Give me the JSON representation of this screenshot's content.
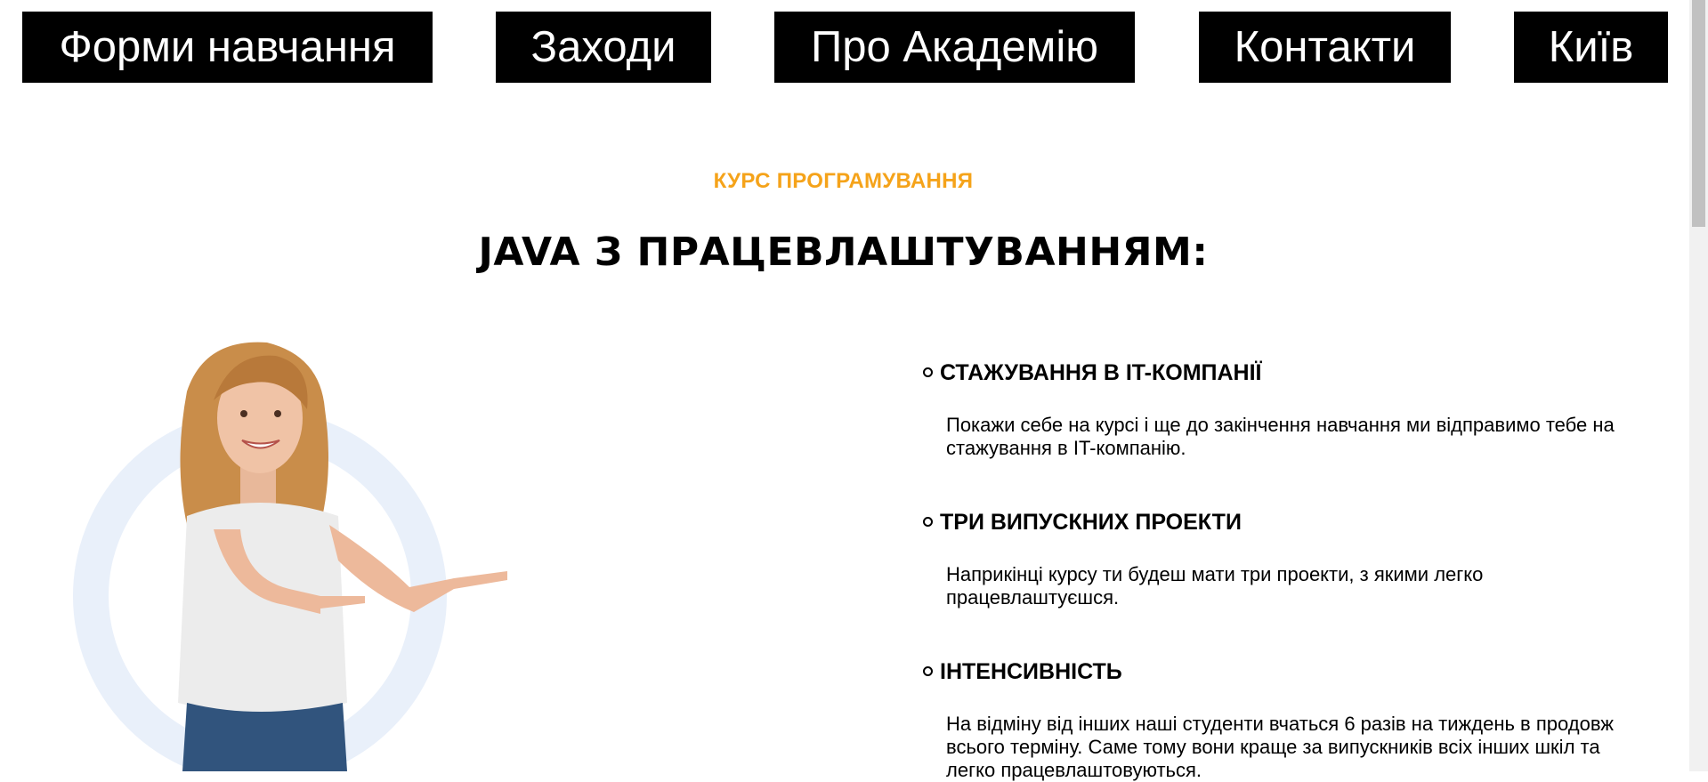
{
  "nav": {
    "items": [
      {
        "label": "Форми навчання"
      },
      {
        "label": "Заходи"
      },
      {
        "label": "Про Академію"
      },
      {
        "label": "Контакти"
      },
      {
        "label": "Київ"
      }
    ]
  },
  "course": {
    "eyebrow": "КУРС ПРОГРАМУВАННЯ",
    "title": "JAVA З ПРАЦЕВЛАШТУВАННЯМ:"
  },
  "features": [
    {
      "title": "СТАЖУВАННЯ В IT-КОМПАНІЇ",
      "desc": "Покажи себе на курсі і ще до закінчення навчання ми відправимо тебе на стажування в IT-компанію."
    },
    {
      "title": "ТРИ ВИПУСКНИХ ПРОЕКТИ",
      "desc": "Наприкінці курсу ти будеш мати три проекти, з якими легко працевлаштуєшся."
    },
    {
      "title": "ІНТЕНСИВНІСТЬ",
      "desc": "На відміну від інших наші студенти вчаться 6 разів на тиждень в продовж всього терміну. Саме тому вони краще за випускників всіх інших шкіл та легко працевлаштовуються."
    }
  ],
  "colors": {
    "accent": "#f5a31a",
    "nav_bg": "#000000",
    "ring": "#e9f0fa"
  }
}
